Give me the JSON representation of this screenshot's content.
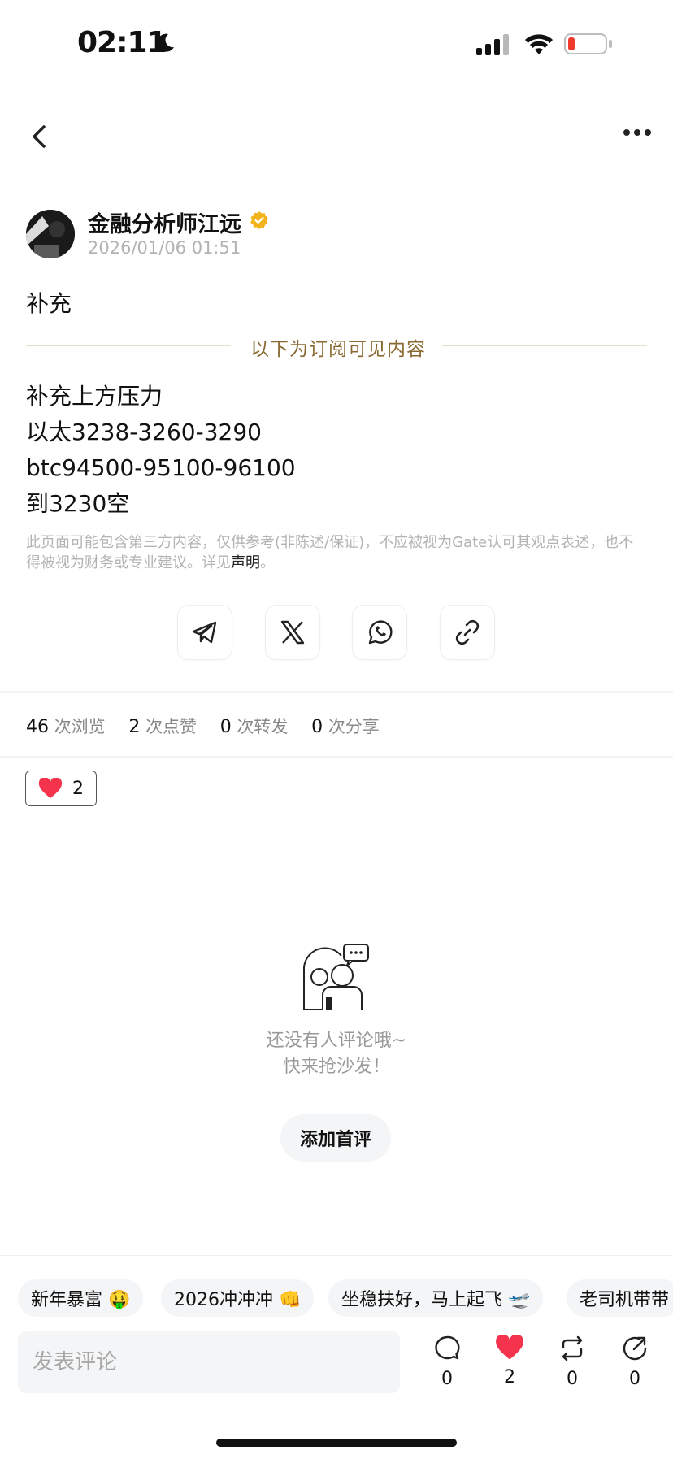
{
  "status_bar": {
    "time": "02:11"
  },
  "post": {
    "author": "金融分析师江远",
    "time": "2026/01/06 01:51",
    "title": "补充",
    "divider_text": "以下为订阅可见内容",
    "lines": [
      "补充上方压力",
      "以太3238-3260-3290",
      "btc94500-95100-96100",
      "到3230空"
    ],
    "disclaimer": "此页面可能包含第三方内容，仅供参考(非陈述/保证)，不应被视为Gate认可其观点表述，也不得被视为财务或专业建议。详见",
    "disclaimer_link": "声明",
    "disclaimer_end": "。"
  },
  "stats": {
    "views": "46",
    "views_label": "次浏览",
    "likes": "2",
    "likes_label": "次点赞",
    "reposts": "0",
    "reposts_label": "次转发",
    "shares": "0",
    "shares_label": "次分享"
  },
  "reaction": {
    "count": "2"
  },
  "comments": {
    "empty_line1": "还没有人评论哦~",
    "empty_line2": "快来抢沙发！",
    "add_first": "添加首评"
  },
  "quick_chips": [
    "新年暴富 🤑",
    "2026冲冲冲 👊",
    "坐稳扶好，马上起飞 🛫",
    "老司机带带"
  ],
  "bottom_bar": {
    "placeholder": "发表评论",
    "comment_count": "0",
    "like_count": "2",
    "repost_count": "0",
    "share_count": "0"
  },
  "colors": {
    "accent_gold": "#8a6a33",
    "like_red": "#f5334d",
    "verified_gold": "#f2b31b"
  }
}
